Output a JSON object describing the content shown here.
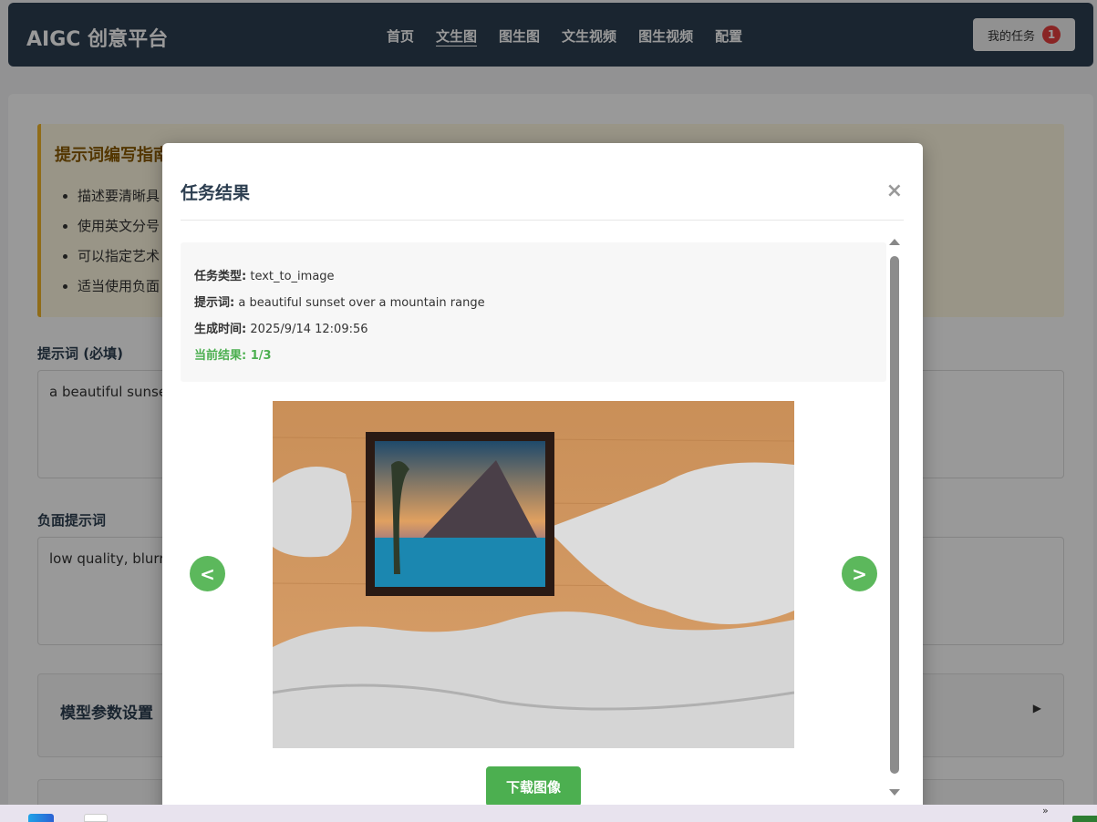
{
  "navbar": {
    "brand": "AIGC 创意平台",
    "links": [
      "首页",
      "文生图",
      "图生图",
      "文生视频",
      "图生视频",
      "配置"
    ],
    "active_index": 1,
    "tasks_label": "我的任务",
    "tasks_count": "1"
  },
  "guide": {
    "title": "提示词编写指南",
    "items": [
      "描述要清晰具",
      "使用英文分号",
      "可以指定艺术",
      "适当使用负面"
    ]
  },
  "prompt": {
    "label": "提示词 (必填)",
    "value": "a beautiful sunset"
  },
  "negative": {
    "label": "负面提示词",
    "value": "low quality, blurry"
  },
  "model_settings": {
    "title": "模型参数设置"
  },
  "modal": {
    "title": "任务结果",
    "close": "×",
    "info": {
      "type_label": "任务类型:",
      "type_value": "text_to_image",
      "prompt_label": "提示词:",
      "prompt_value": "a beautiful sunset over a mountain range",
      "time_label": "生成时间:",
      "time_value": "2025/9/14 12:09:56",
      "current": "当前结果: 1/3"
    },
    "prev": "<",
    "next": ">",
    "download": "下载图像"
  },
  "colors": {
    "navbar": "#2c3e50",
    "accent_green": "#4caf50",
    "badge_red": "#e53e3e"
  }
}
